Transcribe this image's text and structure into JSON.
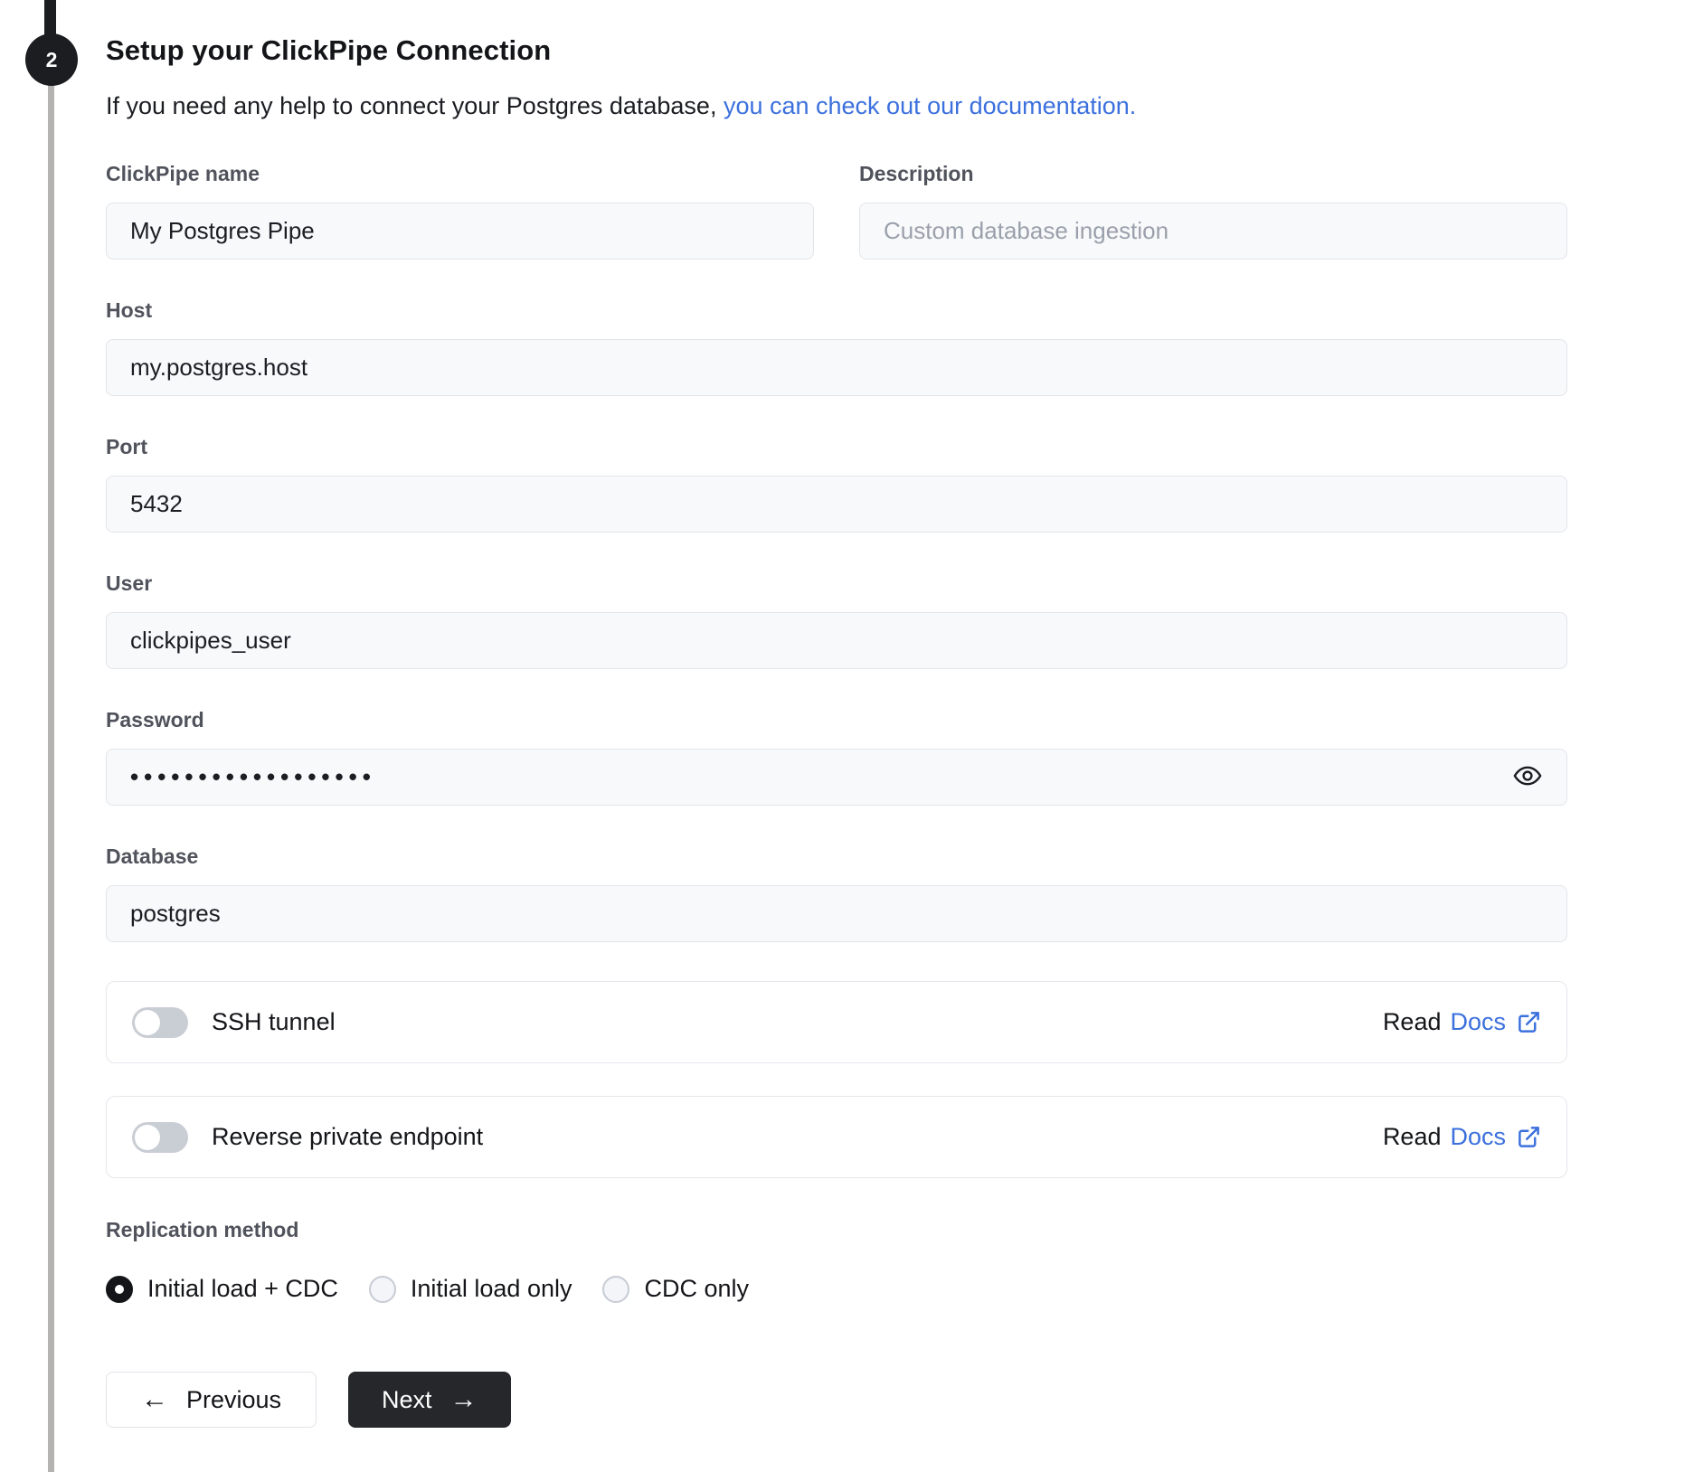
{
  "step": {
    "number": "2"
  },
  "header": {
    "title": "Setup your ClickPipe Connection",
    "subtitle_prefix": "If you need any help to connect your Postgres database, ",
    "subtitle_link": "you can check out our documentation."
  },
  "fields": {
    "clickpipe_name": {
      "label": "ClickPipe name",
      "value": "My Postgres Pipe"
    },
    "description": {
      "label": "Description",
      "value": "",
      "placeholder": "Custom database ingestion"
    },
    "host": {
      "label": "Host",
      "value": "my.postgres.host"
    },
    "port": {
      "label": "Port",
      "value": "5432"
    },
    "user": {
      "label": "User",
      "value": "clickpipes_user"
    },
    "password": {
      "label": "Password",
      "masked_value": "••••••••••••••••••"
    },
    "database": {
      "label": "Database",
      "value": "postgres"
    }
  },
  "toggles": [
    {
      "label": "SSH tunnel",
      "enabled": false,
      "read_label": "Read",
      "docs_label": "Docs"
    },
    {
      "label": "Reverse private endpoint",
      "enabled": false,
      "read_label": "Read",
      "docs_label": "Docs"
    }
  ],
  "replication": {
    "label": "Replication method",
    "options": [
      {
        "label": "Initial load + CDC",
        "selected": true
      },
      {
        "label": "Initial load only",
        "selected": false
      },
      {
        "label": "CDC only",
        "selected": false
      }
    ]
  },
  "buttons": {
    "previous_label": "Previous",
    "next_label": "Next"
  },
  "icons": {
    "arrow_left": "←",
    "arrow_right": "→",
    "eye": "eye-icon",
    "external_link": "external-link-icon"
  },
  "colors": {
    "accent_blue": "#3b70dd",
    "dark_button": "#26272b",
    "step_circle": "#1c1d21",
    "input_background": "#f8f9fb",
    "input_border": "#e3e5ea",
    "toggle_track": "#c9cdd4"
  }
}
